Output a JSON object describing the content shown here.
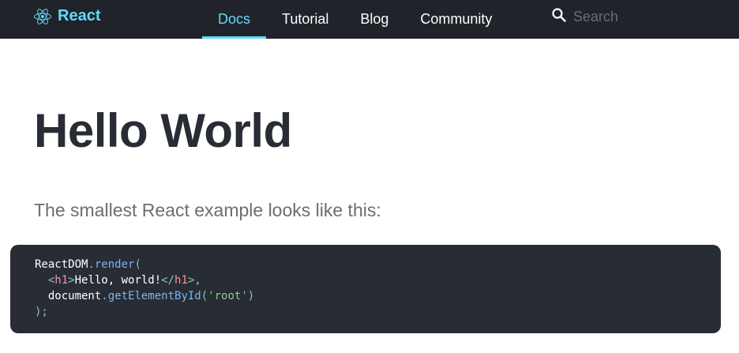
{
  "colors": {
    "nav_bg": "#20232a",
    "accent": "#61dafb",
    "title": "#282c34",
    "intro_text": "#6d6d6d",
    "code_bg": "#282c34"
  },
  "brand": {
    "name": "React",
    "icon": "react-logo-icon"
  },
  "nav": {
    "items": [
      {
        "label": "Docs",
        "active": true
      },
      {
        "label": "Tutorial",
        "active": false
      },
      {
        "label": "Blog",
        "active": false
      },
      {
        "label": "Community",
        "active": false
      }
    ]
  },
  "search": {
    "placeholder": "Search",
    "value": "",
    "icon": "search-icon"
  },
  "main": {
    "title": "Hello World",
    "intro": "The smallest React example looks like this:"
  },
  "code": {
    "line1": {
      "obj": "ReactDOM",
      "dot": ".",
      "fn": "render",
      "open": "("
    },
    "line2": {
      "indent": "  ",
      "lt": "<",
      "tag": "h1",
      "gt": ">",
      "text": "Hello, world!",
      "lt_close": "</",
      "tag_close": "h1",
      "gt_close": ">",
      "comma": ","
    },
    "line3": {
      "indent": "  ",
      "obj": "document",
      "dot": ".",
      "fn": "getElementById",
      "open": "(",
      "arg": "'root'",
      "close": ")"
    },
    "line4": {
      "close": ");"
    }
  }
}
